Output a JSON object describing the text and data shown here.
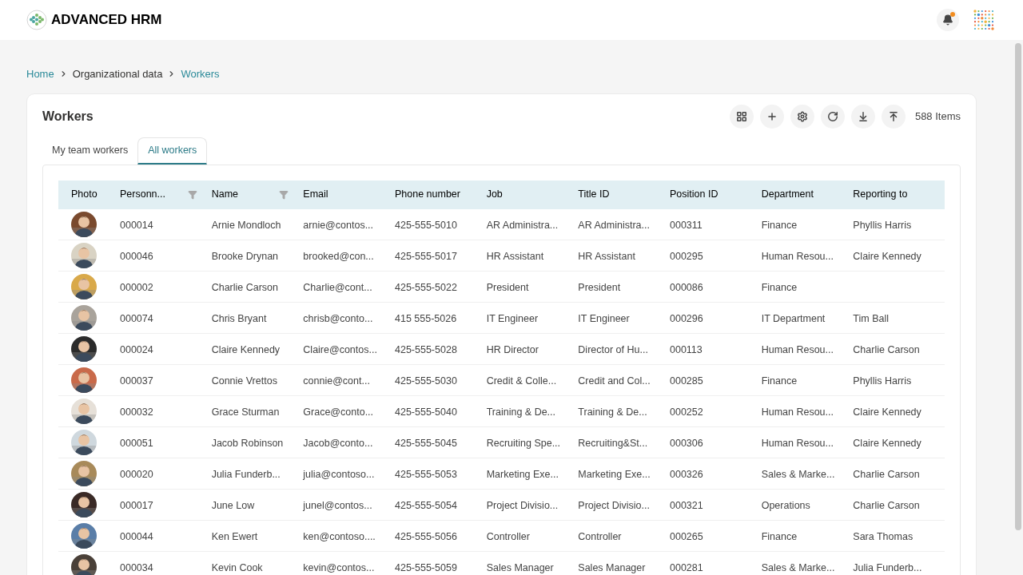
{
  "app": {
    "name": "ADVANCED HRM",
    "notifications": {
      "unread": true
    }
  },
  "breadcrumb": [
    {
      "label": "Home",
      "link": true
    },
    {
      "label": "Organizational data",
      "link": false
    },
    {
      "label": "Workers",
      "link": true
    }
  ],
  "page": {
    "title": "Workers",
    "item_count": "588 Items"
  },
  "tabs": [
    {
      "label": "My team workers",
      "selected": false
    },
    {
      "label": "All workers",
      "selected": true
    }
  ],
  "table": {
    "columns": [
      {
        "label": "Photo",
        "filter": false
      },
      {
        "label": "Personn...",
        "filter": true
      },
      {
        "label": "Name",
        "filter": true
      },
      {
        "label": "Email",
        "filter": false
      },
      {
        "label": "Phone number",
        "filter": false
      },
      {
        "label": "Job",
        "filter": false
      },
      {
        "label": "Title ID",
        "filter": false
      },
      {
        "label": "Position ID",
        "filter": false
      },
      {
        "label": "Department",
        "filter": false
      },
      {
        "label": "Reporting to",
        "filter": false
      }
    ],
    "rows": [
      {
        "cells": [
          "",
          "000014",
          "Arnie Mondloch",
          "arnie@contos...",
          "425-555-5010",
          "AR Administra...",
          "AR Administra...",
          "000311",
          "Finance",
          "Phyllis Harris"
        ]
      },
      {
        "cells": [
          "",
          "000046",
          "Brooke Drynan",
          "brooked@con...",
          "425-555-5017",
          "HR Assistant",
          "HR Assistant",
          "000295",
          "Human Resou...",
          "Claire Kennedy"
        ]
      },
      {
        "cells": [
          "",
          "000002",
          "Charlie Carson",
          "Charlie@cont...",
          "425-555-5022",
          "President",
          "President",
          "000086",
          "Finance",
          ""
        ]
      },
      {
        "cells": [
          "",
          "000074",
          "Chris Bryant",
          "chrisb@conto...",
          "415 555-5026",
          "IT Engineer",
          "IT Engineer",
          "000296",
          "IT Department",
          "Tim Ball"
        ]
      },
      {
        "cells": [
          "",
          "000024",
          "Claire Kennedy",
          "Claire@contos...",
          "425-555-5028",
          "HR Director",
          "Director of Hu...",
          "000113",
          "Human Resou...",
          "Charlie Carson"
        ]
      },
      {
        "cells": [
          "",
          "000037",
          "Connie Vrettos",
          "connie@cont...",
          "425-555-5030",
          "Credit & Colle...",
          "Credit and Col...",
          "000285",
          "Finance",
          "Phyllis Harris"
        ]
      },
      {
        "cells": [
          "",
          "000032",
          "Grace Sturman",
          "Grace@conto...",
          "425-555-5040",
          "Training & De...",
          "Training & De...",
          "000252",
          "Human Resou...",
          "Claire Kennedy"
        ]
      },
      {
        "cells": [
          "",
          "000051",
          "Jacob Robinson",
          "Jacob@conto...",
          "425-555-5045",
          "Recruiting Spe...",
          "Recruiting&St...",
          "000306",
          "Human Resou...",
          "Claire Kennedy"
        ]
      },
      {
        "cells": [
          "",
          "000020",
          "Julia Funderb...",
          "julia@contoso...",
          "425-555-5053",
          "Marketing Exe...",
          "Marketing Exe...",
          "000326",
          "Sales & Marke...",
          "Charlie Carson"
        ]
      },
      {
        "cells": [
          "",
          "000017",
          "June Low",
          "junel@contos...",
          "425-555-5054",
          "Project Divisio...",
          "Project Divisio...",
          "000321",
          "Operations",
          "Charlie Carson"
        ]
      },
      {
        "cells": [
          "",
          "000044",
          "Ken Ewert",
          "ken@contoso....",
          "425-555-5056",
          "Controller",
          "Controller",
          "000265",
          "Finance",
          "Sara Thomas"
        ]
      },
      {
        "cells": [
          "",
          "000034",
          "Kevin Cook",
          "kevin@contos...",
          "425-555-5059",
          "Sales Manager",
          "Sales Manager",
          "000281",
          "Sales & Marke...",
          "Julia Funderb..."
        ]
      }
    ]
  }
}
